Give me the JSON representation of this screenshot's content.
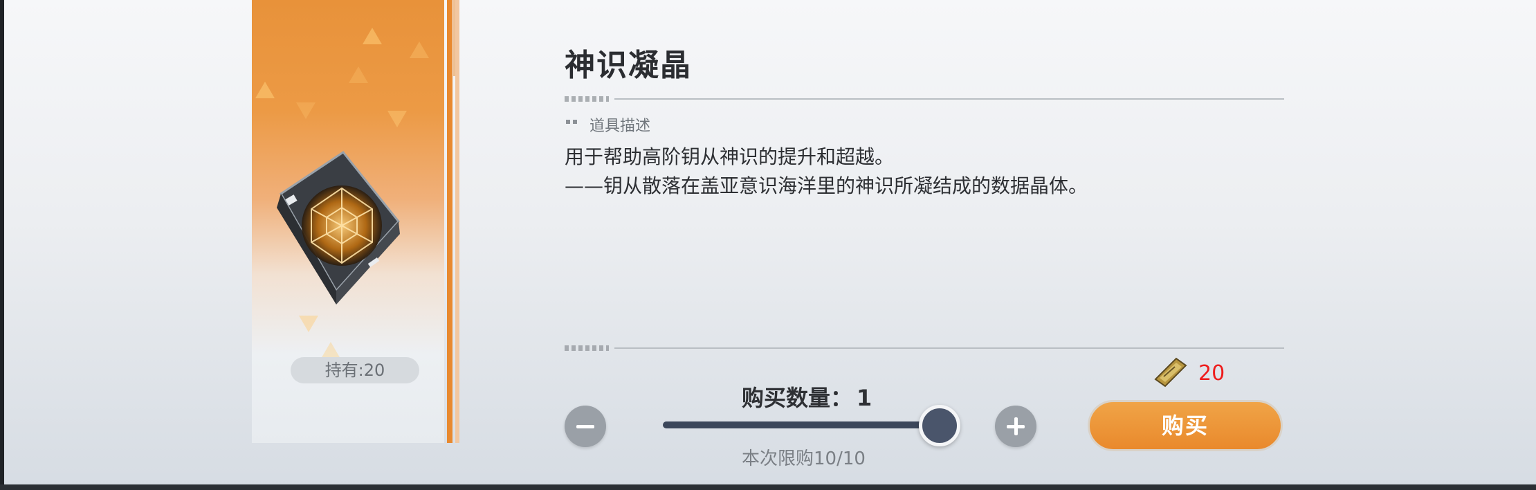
{
  "item": {
    "title": "神识凝晶",
    "owned": "持有:20",
    "icon": "crystal-cube-icon"
  },
  "description": {
    "section_label": "道具描述",
    "lines": [
      "用于帮助高阶钥从神识的提升和超越。",
      "——钥从散落在盖亚意识海洋里的神识所凝结成的数据晶体。"
    ]
  },
  "purchase": {
    "quantity_label": "购买数量：",
    "quantity_value": "1",
    "quantity_current": 1,
    "quantity_max": 1,
    "limit_text": "本次限购10/10",
    "price": "20",
    "price_icon": "gold-ticket-icon",
    "buy_label": "购买",
    "minus_icon": "minus-icon",
    "plus_icon": "plus-icon"
  },
  "colors": {
    "accent_orange": "#e9892c",
    "price_red": "#ee1c1c",
    "slider_fill": "#3b465a"
  }
}
